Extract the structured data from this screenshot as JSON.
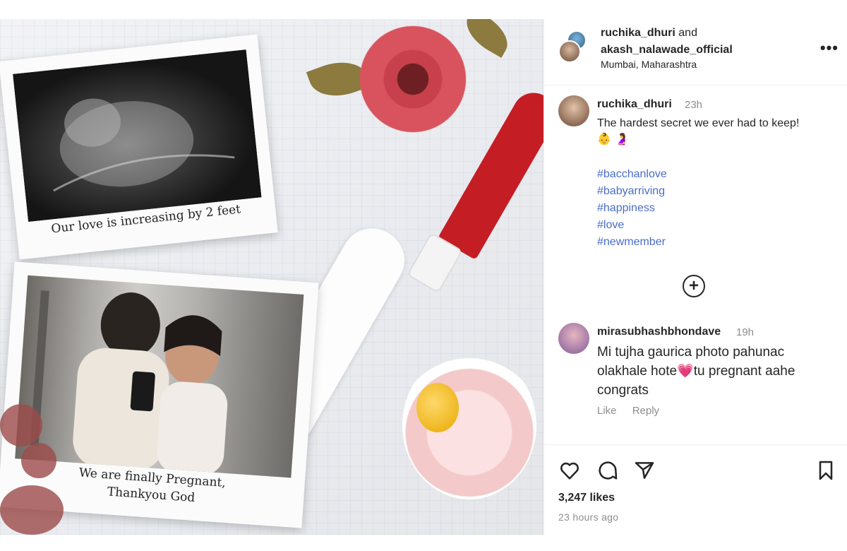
{
  "post": {
    "polaroid_top_caption": "Our love is increasing by 2 feet",
    "polaroid_bottom_caption_line1": "We are finally Pregnant,",
    "polaroid_bottom_caption_line2": "Thankyou God"
  },
  "header": {
    "owner1": "ruchika_dhuri",
    "and_text": "and",
    "owner2": "akash_nalawade_official",
    "location": "Mumbai, Maharashtra",
    "more_icon": "more-horizontal-icon"
  },
  "caption": {
    "username": "ruchika_dhuri",
    "time": "23h",
    "text": "The hardest secret we ever had to keep!",
    "emojis": [
      "👶",
      "🤰"
    ],
    "hashtags": [
      "#bacchanlove",
      "#babyarriving",
      "#happiness",
      "#love",
      "#newmember"
    ]
  },
  "load_more_icon": "plus-circle-icon",
  "comment": {
    "username": "mirasubhashbhondave",
    "time": "19h",
    "text_line1": "Mi tujha gaurica photo pahunac",
    "text_line2a": "olakhale hote",
    "heart": "💗",
    "text_line2b": "tu pregnant aahe",
    "text_line3": "congrats",
    "like_label": "Like",
    "reply_label": "Reply"
  },
  "footer": {
    "likes": "3,247 likes",
    "time_ago": "23 hours ago"
  },
  "colors": {
    "hashtag": "#4a6ec5",
    "meta": "#8e8e8e",
    "text": "#262626"
  }
}
